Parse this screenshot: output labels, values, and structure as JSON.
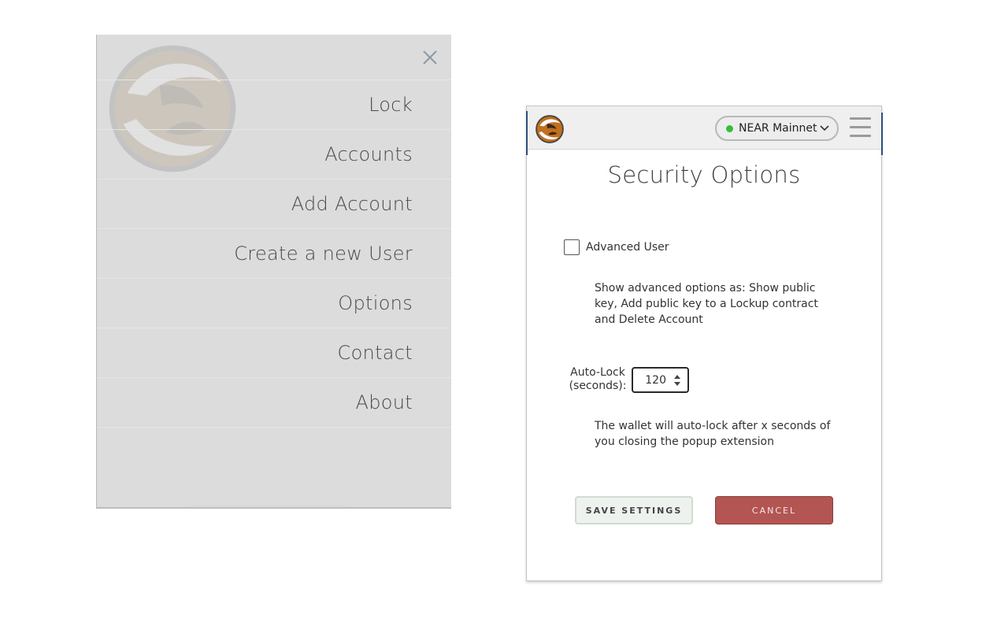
{
  "menu": {
    "items": [
      {
        "label": "Lock"
      },
      {
        "label": "Accounts"
      },
      {
        "label": "Add Account"
      },
      {
        "label": "Create a new User"
      },
      {
        "label": "Options"
      },
      {
        "label": "Contact"
      },
      {
        "label": "About"
      }
    ],
    "close_icon": "close-icon",
    "logo_icon": "narwallets-logo"
  },
  "header": {
    "network": "NEAR Mainnet",
    "network_status_color": "#2fbf3a",
    "logo_icon": "narwallets-logo",
    "menu_icon": "hamburger-icon"
  },
  "security": {
    "title": "Security Options",
    "advanced_user_label": "Advanced User",
    "advanced_user_checked": false,
    "advanced_desc": "Show advanced options as: Show public key, Add public key to a Lockup contract and Delete Account",
    "autolock_label_line1": "Auto-Lock",
    "autolock_label_line2": "(seconds):",
    "autolock_value": "120",
    "autolock_desc": "The wallet will auto-lock after x seconds of you closing the popup extension",
    "save_label": "SAVE SETTINGS",
    "cancel_label": "CANCEL"
  },
  "colors": {
    "cancel_button": "#b35553",
    "accent_border": "#2d4f7c"
  }
}
